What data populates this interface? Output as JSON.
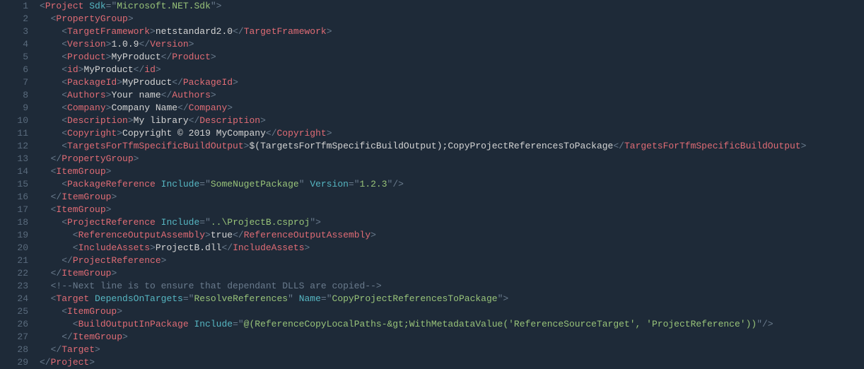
{
  "lineCount": 29,
  "lines": [
    [
      {
        "c": "p",
        "t": "<"
      },
      {
        "c": "tag",
        "t": "Project"
      },
      {
        "c": "p",
        "t": " "
      },
      {
        "c": "attr",
        "t": "Sdk"
      },
      {
        "c": "p",
        "t": "=\""
      },
      {
        "c": "str",
        "t": "Microsoft.NET.Sdk"
      },
      {
        "c": "p",
        "t": "\">"
      }
    ],
    [
      {
        "c": "p",
        "t": "  <"
      },
      {
        "c": "tag",
        "t": "PropertyGroup"
      },
      {
        "c": "p",
        "t": ">"
      }
    ],
    [
      {
        "c": "p",
        "t": "    <"
      },
      {
        "c": "tag",
        "t": "TargetFramework"
      },
      {
        "c": "p",
        "t": ">"
      },
      {
        "c": "txt",
        "t": "netstandard2.0"
      },
      {
        "c": "p",
        "t": "</"
      },
      {
        "c": "tag",
        "t": "TargetFramework"
      },
      {
        "c": "p",
        "t": ">"
      }
    ],
    [
      {
        "c": "p",
        "t": "    <"
      },
      {
        "c": "tag",
        "t": "Version"
      },
      {
        "c": "p",
        "t": ">"
      },
      {
        "c": "txt",
        "t": "1.0.9"
      },
      {
        "c": "p",
        "t": "</"
      },
      {
        "c": "tag",
        "t": "Version"
      },
      {
        "c": "p",
        "t": ">"
      }
    ],
    [
      {
        "c": "p",
        "t": "    <"
      },
      {
        "c": "tag",
        "t": "Product"
      },
      {
        "c": "p",
        "t": ">"
      },
      {
        "c": "txt",
        "t": "MyProduct"
      },
      {
        "c": "p",
        "t": "</"
      },
      {
        "c": "tag",
        "t": "Product"
      },
      {
        "c": "p",
        "t": ">"
      }
    ],
    [
      {
        "c": "p",
        "t": "    <"
      },
      {
        "c": "tag",
        "t": "id"
      },
      {
        "c": "p",
        "t": ">"
      },
      {
        "c": "txt",
        "t": "MyProduct"
      },
      {
        "c": "p",
        "t": "</"
      },
      {
        "c": "tag",
        "t": "id"
      },
      {
        "c": "p",
        "t": ">"
      }
    ],
    [
      {
        "c": "p",
        "t": "    <"
      },
      {
        "c": "tag",
        "t": "PackageId"
      },
      {
        "c": "p",
        "t": ">"
      },
      {
        "c": "txt",
        "t": "MyProduct"
      },
      {
        "c": "p",
        "t": "</"
      },
      {
        "c": "tag",
        "t": "PackageId"
      },
      {
        "c": "p",
        "t": ">"
      }
    ],
    [
      {
        "c": "p",
        "t": "    <"
      },
      {
        "c": "tag",
        "t": "Authors"
      },
      {
        "c": "p",
        "t": ">"
      },
      {
        "c": "txt",
        "t": "Your name"
      },
      {
        "c": "p",
        "t": "</"
      },
      {
        "c": "tag",
        "t": "Authors"
      },
      {
        "c": "p",
        "t": ">"
      }
    ],
    [
      {
        "c": "p",
        "t": "    <"
      },
      {
        "c": "tag",
        "t": "Company"
      },
      {
        "c": "p",
        "t": ">"
      },
      {
        "c": "txt",
        "t": "Company Name"
      },
      {
        "c": "p",
        "t": "</"
      },
      {
        "c": "tag",
        "t": "Company"
      },
      {
        "c": "p",
        "t": ">"
      }
    ],
    [
      {
        "c": "p",
        "t": "    <"
      },
      {
        "c": "tag",
        "t": "Description"
      },
      {
        "c": "p",
        "t": ">"
      },
      {
        "c": "txt",
        "t": "My library"
      },
      {
        "c": "p",
        "t": "</"
      },
      {
        "c": "tag",
        "t": "Description"
      },
      {
        "c": "p",
        "t": ">"
      }
    ],
    [
      {
        "c": "p",
        "t": "    <"
      },
      {
        "c": "tag",
        "t": "Copyright"
      },
      {
        "c": "p",
        "t": ">"
      },
      {
        "c": "txt",
        "t": "Copyright © 2019 MyCompany"
      },
      {
        "c": "p",
        "t": "</"
      },
      {
        "c": "tag",
        "t": "Copyright"
      },
      {
        "c": "p",
        "t": ">"
      }
    ],
    [
      {
        "c": "p",
        "t": "    <"
      },
      {
        "c": "tag",
        "t": "TargetsForTfmSpecificBuildOutput"
      },
      {
        "c": "p",
        "t": ">"
      },
      {
        "c": "txt",
        "t": "$(TargetsForTfmSpecificBuildOutput);CopyProjectReferencesToPackage"
      },
      {
        "c": "p",
        "t": "</"
      },
      {
        "c": "tag",
        "t": "TargetsForTfmSpecificBuildOutput"
      },
      {
        "c": "p",
        "t": ">"
      }
    ],
    [
      {
        "c": "p",
        "t": "  </"
      },
      {
        "c": "tag",
        "t": "PropertyGroup"
      },
      {
        "c": "p",
        "t": ">"
      }
    ],
    [
      {
        "c": "p",
        "t": "  <"
      },
      {
        "c": "tag",
        "t": "ItemGroup"
      },
      {
        "c": "p",
        "t": ">"
      }
    ],
    [
      {
        "c": "p",
        "t": "    <"
      },
      {
        "c": "tag",
        "t": "PackageReference"
      },
      {
        "c": "p",
        "t": " "
      },
      {
        "c": "attr",
        "t": "Include"
      },
      {
        "c": "p",
        "t": "=\""
      },
      {
        "c": "str",
        "t": "SomeNugetPackage"
      },
      {
        "c": "p",
        "t": "\" "
      },
      {
        "c": "attr",
        "t": "Version"
      },
      {
        "c": "p",
        "t": "=\""
      },
      {
        "c": "str",
        "t": "1.2.3"
      },
      {
        "c": "p",
        "t": "\"/>"
      }
    ],
    [
      {
        "c": "p",
        "t": "  </"
      },
      {
        "c": "tag",
        "t": "ItemGroup"
      },
      {
        "c": "p",
        "t": ">"
      }
    ],
    [
      {
        "c": "p",
        "t": "  <"
      },
      {
        "c": "tag",
        "t": "ItemGroup"
      },
      {
        "c": "p",
        "t": ">"
      }
    ],
    [
      {
        "c": "p",
        "t": "    <"
      },
      {
        "c": "tag",
        "t": "ProjectReference"
      },
      {
        "c": "p",
        "t": " "
      },
      {
        "c": "attr",
        "t": "Include"
      },
      {
        "c": "p",
        "t": "=\""
      },
      {
        "c": "str",
        "t": "..\\ProjectB.csproj"
      },
      {
        "c": "p",
        "t": "\">"
      }
    ],
    [
      {
        "c": "p",
        "t": "      <"
      },
      {
        "c": "tag",
        "t": "ReferenceOutputAssembly"
      },
      {
        "c": "p",
        "t": ">"
      },
      {
        "c": "txt",
        "t": "true"
      },
      {
        "c": "p",
        "t": "</"
      },
      {
        "c": "tag",
        "t": "ReferenceOutputAssembly"
      },
      {
        "c": "p",
        "t": ">"
      }
    ],
    [
      {
        "c": "p",
        "t": "      <"
      },
      {
        "c": "tag",
        "t": "IncludeAssets"
      },
      {
        "c": "p",
        "t": ">"
      },
      {
        "c": "txt",
        "t": "ProjectB.dll"
      },
      {
        "c": "p",
        "t": "</"
      },
      {
        "c": "tag",
        "t": "IncludeAssets"
      },
      {
        "c": "p",
        "t": ">"
      }
    ],
    [
      {
        "c": "p",
        "t": "    </"
      },
      {
        "c": "tag",
        "t": "ProjectReference"
      },
      {
        "c": "p",
        "t": ">"
      }
    ],
    [
      {
        "c": "p",
        "t": "  </"
      },
      {
        "c": "tag",
        "t": "ItemGroup"
      },
      {
        "c": "p",
        "t": ">"
      }
    ],
    [
      {
        "c": "cmt",
        "t": "  <!--Next line is to ensure that dependant DLLS are copied-->"
      }
    ],
    [
      {
        "c": "p",
        "t": "  <"
      },
      {
        "c": "tag",
        "t": "Target"
      },
      {
        "c": "p",
        "t": " "
      },
      {
        "c": "attr",
        "t": "DependsOnTargets"
      },
      {
        "c": "p",
        "t": "=\""
      },
      {
        "c": "str",
        "t": "ResolveReferences"
      },
      {
        "c": "p",
        "t": "\" "
      },
      {
        "c": "attr",
        "t": "Name"
      },
      {
        "c": "p",
        "t": "=\""
      },
      {
        "c": "str",
        "t": "CopyProjectReferencesToPackage"
      },
      {
        "c": "p",
        "t": "\">"
      }
    ],
    [
      {
        "c": "p",
        "t": "    <"
      },
      {
        "c": "tag",
        "t": "ItemGroup"
      },
      {
        "c": "p",
        "t": ">"
      }
    ],
    [
      {
        "c": "p",
        "t": "      <"
      },
      {
        "c": "tag",
        "t": "BuildOutputInPackage"
      },
      {
        "c": "p",
        "t": " "
      },
      {
        "c": "attr",
        "t": "Include"
      },
      {
        "c": "p",
        "t": "=\""
      },
      {
        "c": "str",
        "t": "@(ReferenceCopyLocalPaths-&gt;WithMetadataValue('ReferenceSourceTarget', 'ProjectReference'))"
      },
      {
        "c": "p",
        "t": "\"/>"
      }
    ],
    [
      {
        "c": "p",
        "t": "    </"
      },
      {
        "c": "tag",
        "t": "ItemGroup"
      },
      {
        "c": "p",
        "t": ">"
      }
    ],
    [
      {
        "c": "p",
        "t": "  </"
      },
      {
        "c": "tag",
        "t": "Target"
      },
      {
        "c": "p",
        "t": ">"
      }
    ],
    [
      {
        "c": "p",
        "t": "</"
      },
      {
        "c": "tag",
        "t": "Project"
      },
      {
        "c": "p",
        "t": ">"
      }
    ]
  ]
}
